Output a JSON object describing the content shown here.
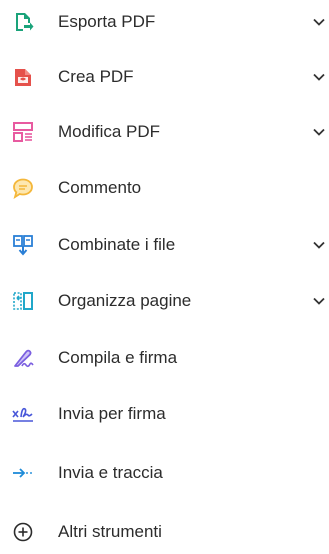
{
  "tools": [
    {
      "label": "Esporta PDF",
      "icon": "export-pdf-icon",
      "color": "#1aa37a",
      "expandable": true
    },
    {
      "label": "Crea PDF",
      "icon": "create-pdf-icon",
      "color": "#e5514b",
      "expandable": true
    },
    {
      "label": "Modifica PDF",
      "icon": "edit-pdf-icon",
      "color": "#e85aa0",
      "expandable": true
    },
    {
      "label": "Commento",
      "icon": "comment-icon",
      "color": "#f4b73a",
      "expandable": false
    },
    {
      "label": "Combinate i file",
      "icon": "combine-files-icon",
      "color": "#2a7fd6",
      "expandable": true
    },
    {
      "label": "Organizza pagine",
      "icon": "organize-pages-icon",
      "color": "#20a7c9",
      "expandable": true
    },
    {
      "label": "Compila e firma",
      "icon": "fill-sign-icon",
      "color": "#7b5fe0",
      "expandable": false
    },
    {
      "label": "Invia per firma",
      "icon": "send-for-signature-icon",
      "color": "#4857d9",
      "expandable": false
    },
    {
      "label": "Invia e traccia",
      "icon": "send-track-icon",
      "color": "#1e8bd8",
      "expandable": false
    },
    {
      "label": "Altri strumenti",
      "icon": "more-tools-icon",
      "color": "#2c2c2c",
      "expandable": false
    }
  ]
}
